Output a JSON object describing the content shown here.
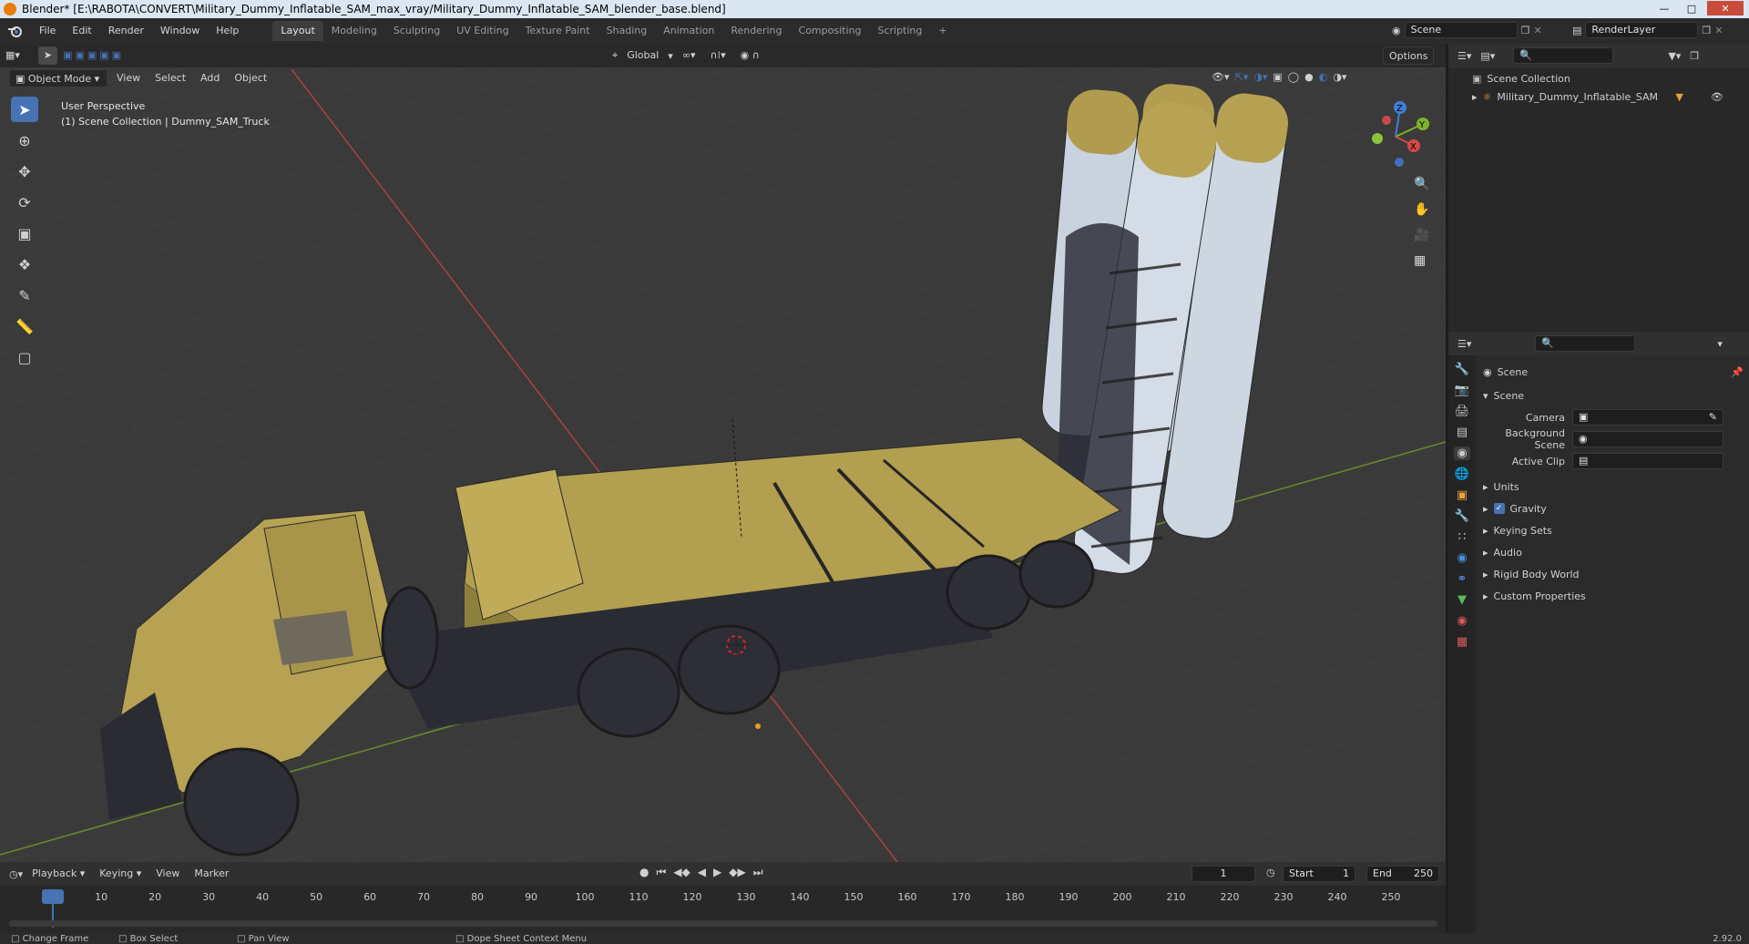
{
  "window": {
    "title": "Blender* [E:\\RABOTA\\CONVERT\\Military_Dummy_Inflatable_SAM_max_vray/Military_Dummy_Inflatable_SAM_blender_base.blend]"
  },
  "menu": [
    "File",
    "Edit",
    "Render",
    "Window",
    "Help"
  ],
  "workspaces": [
    "Layout",
    "Modeling",
    "Sculpting",
    "UV Editing",
    "Texture Paint",
    "Shading",
    "Animation",
    "Rendering",
    "Compositing",
    "Scripting"
  ],
  "active_workspace": "Layout",
  "scene_field": "Scene",
  "renderlayer_field": "RenderLayer",
  "viewport_header": {
    "mode": "Object Mode",
    "menus": [
      "View",
      "Select",
      "Add",
      "Object"
    ],
    "orientation": "Global",
    "options": "Options"
  },
  "viewport": {
    "perspective": "User Perspective",
    "collection": "(1) Scene Collection | Dummy_SAM_Truck",
    "gizmo": {
      "z": "Z",
      "y": "Y",
      "x": "X"
    }
  },
  "outliner": {
    "root": "Scene Collection",
    "items": [
      {
        "label": "Military_Dummy_Inflatable_SAM"
      }
    ]
  },
  "properties": {
    "header": "Scene",
    "section": "Scene",
    "fields": [
      {
        "label": "Camera"
      },
      {
        "label": "Background Scene"
      },
      {
        "label": "Active Clip"
      }
    ],
    "subsections": [
      {
        "label": "Units",
        "checkbox": false
      },
      {
        "label": "Gravity",
        "checkbox": true
      },
      {
        "label": "Keying Sets",
        "checkbox": false
      },
      {
        "label": "Audio",
        "checkbox": false
      },
      {
        "label": "Rigid Body World",
        "checkbox": false
      },
      {
        "label": "Custom Properties",
        "checkbox": false
      }
    ]
  },
  "timeline": {
    "menus": [
      "Playback",
      "Keying",
      "View",
      "Marker"
    ],
    "current_frame": "1",
    "start_label": "Start",
    "start": "1",
    "end_label": "End",
    "end": "250",
    "ticks": [
      "1",
      "10",
      "20",
      "30",
      "40",
      "50",
      "60",
      "70",
      "80",
      "90",
      "100",
      "110",
      "120",
      "130",
      "140",
      "150",
      "160",
      "170",
      "180",
      "190",
      "200",
      "210",
      "220",
      "230",
      "240",
      "250"
    ]
  },
  "statusbar": {
    "items": [
      "Change Frame",
      "Box Select",
      "Pan View",
      "Dope Sheet Context Menu"
    ],
    "version": "2.92.0"
  }
}
